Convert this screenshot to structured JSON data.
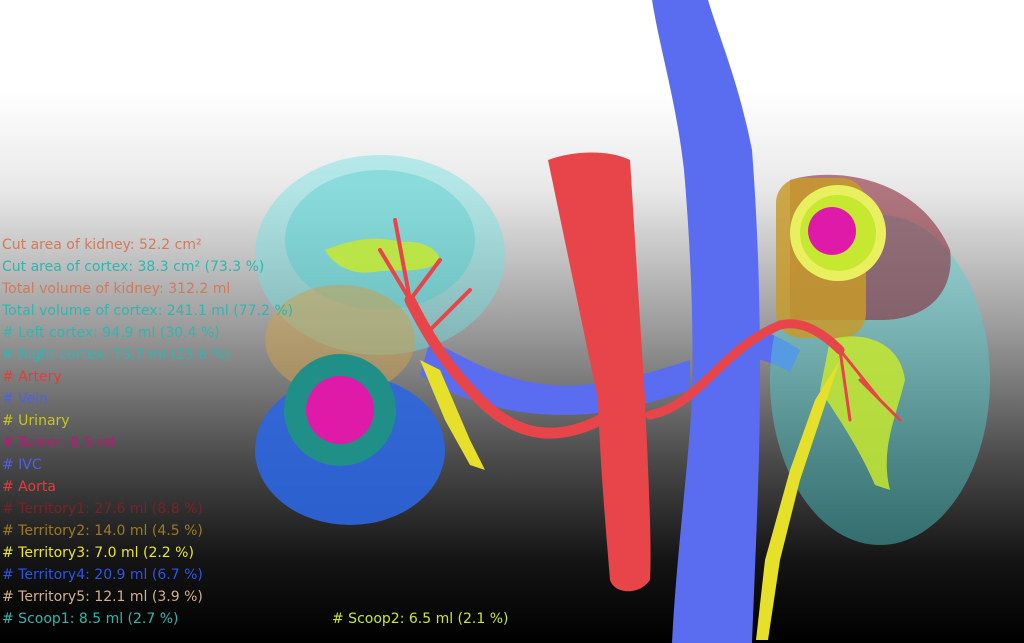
{
  "viewer": {
    "measurements": {
      "cut_area_kidney": "Cut area of kidney: 52.2 cm²",
      "cut_area_cortex": "Cut area of cortex: 38.3 cm² (73.3 %)",
      "total_volume_kidney": "Total volume of kidney: 312.2 ml",
      "total_volume_cortex": "Total volume of cortex: 241.1 ml (77.2 %)"
    },
    "legend": [
      {
        "text": "# Left cortex: 94.9 ml (30.4 %)",
        "color": "#2fb6b0"
      },
      {
        "text": "# Right cortex: 73.7 ml (23.6 %)",
        "color": "#2fb6b0"
      },
      {
        "text": "# Artery",
        "color": "#e53b3b"
      },
      {
        "text": "# Vein",
        "color": "#4b62e6"
      },
      {
        "text": "# Urinary",
        "color": "#c8c41a"
      },
      {
        "text": "# Tumor: 8.5 ml",
        "color": "#c0157a"
      },
      {
        "text": "# IVC",
        "color": "#4b62e6"
      },
      {
        "text": "# Aorta",
        "color": "#e53b3b"
      },
      {
        "text": "# Territory1: 27.6 ml (8.8 %)",
        "color": "#7a2228"
      },
      {
        "text": "# Territory2: 14.0 ml (4.5 %)",
        "color": "#9c7a22"
      },
      {
        "text": "# Territory3: 7.0 ml (2.2 %)",
        "color": "#e8e630"
      },
      {
        "text": "# Territory4: 20.9 ml (6.7 %)",
        "color": "#2b55e6"
      },
      {
        "text": "# Territory5: 12.1 ml (3.9 %)",
        "color": "#d0b090"
      },
      {
        "text": "# Scoop1: 8.5 ml (2.7 %)",
        "color": "#2fb6b0"
      }
    ],
    "scoop2": {
      "text": "# Scoop2: 6.5 ml (2.1 %)",
      "color": "#c6e830"
    },
    "colors": {
      "measurement": "#d07a5a",
      "measurement_cortex": "#2fb6b0",
      "artery": "#e8454a",
      "vein": "#5a6df0",
      "urinary": "#e6e02a",
      "tumor": "#e01aa8",
      "cortex": "#4fd0d0"
    }
  }
}
